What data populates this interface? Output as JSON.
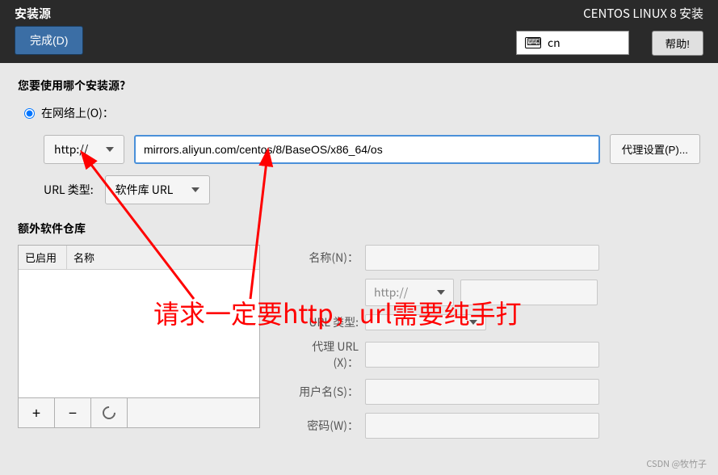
{
  "header": {
    "title": "安装源",
    "done_label": "完成(D)",
    "product": "CENTOS LINUX 8 安装",
    "lang_code": "cn",
    "help_label": "帮助!"
  },
  "source": {
    "question": "您要使用哪个安装源?",
    "network_label": "在网络上(O)：",
    "protocol": "http://",
    "url_value": "mirrors.aliyun.com/centos/8/BaseOS/x86_64/os",
    "proxy_label": "代理设置(P)...",
    "urltype_label": "URL 类型:",
    "urltype_value": "软件库 URL"
  },
  "extra": {
    "section_title": "额外软件仓库",
    "col_enabled": "已启用",
    "col_name": "名称",
    "btn_add": "+",
    "btn_remove": "−",
    "form": {
      "name_label": "名称(N)：",
      "proto_value": "http://",
      "urltype_label": "URL 类型:",
      "proxy_label": "代理 URL (X)：",
      "user_label": "用户名(S)：",
      "pass_label": "密码(W)："
    }
  },
  "annotation": "请求一定要http，url需要纯手打",
  "watermark": "CSDN @牧竹子"
}
